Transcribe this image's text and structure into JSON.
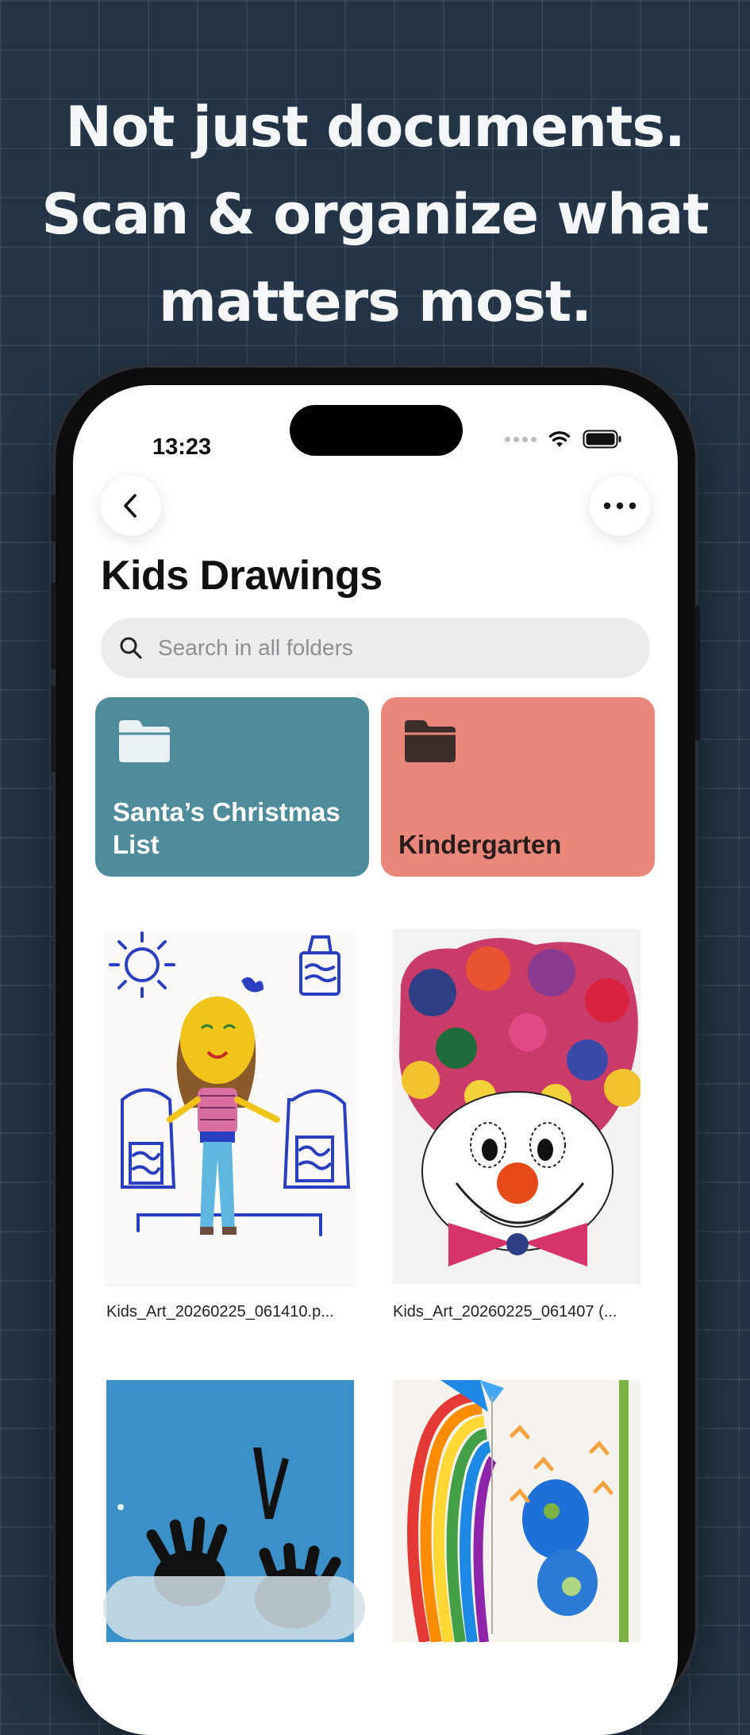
{
  "headline": {
    "line1": "Not just documents.",
    "line2": "Scan & organize what",
    "line3": "matters most."
  },
  "status_bar": {
    "time": "13:23"
  },
  "nav": {
    "back_icon": "chevron-left-icon",
    "more_icon": "ellipsis-icon"
  },
  "page": {
    "title": "Kids Drawings"
  },
  "search": {
    "placeholder": "Search in all folders"
  },
  "folders": [
    {
      "label": "Santa’s Christmas List",
      "color": "#4e8c9c",
      "icon_color": "#e8f0f3",
      "text_color": "#ffffff"
    },
    {
      "label": "Kindergarten",
      "color": "#e8877a",
      "icon_color": "#3d2e2c",
      "text_color": "#2a1c1a"
    }
  ],
  "files": [
    {
      "name": "Kids_Art_20260225_061410.p..."
    },
    {
      "name": "Kids_Art_20260225_061407 (..."
    },
    {
      "name": ""
    },
    {
      "name": ""
    }
  ],
  "colors": {
    "background": "#233446",
    "headline": "#f4f6f8"
  }
}
